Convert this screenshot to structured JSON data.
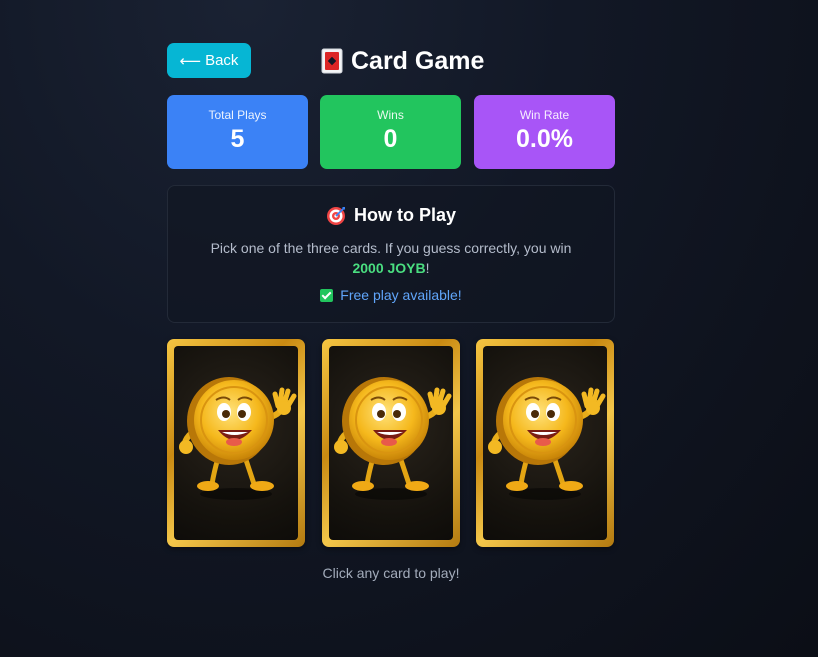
{
  "header": {
    "back_label": "Back",
    "title": "Card Game",
    "title_icon": "playing-card-icon"
  },
  "stats": {
    "total_plays_label": "Total Plays",
    "total_plays_value": "5",
    "wins_label": "Wins",
    "wins_value": "0",
    "win_rate_label": "Win Rate",
    "win_rate_value": "0.0%"
  },
  "howto": {
    "title": "How to Play",
    "icon": "target-icon",
    "text_before": "Pick one of the three cards. If you guess correctly, you win",
    "prize": "2000 JOYB",
    "text_after": "!",
    "free_play": "Free play available!"
  },
  "cards": {
    "count": 3,
    "image": "coin-mascot"
  },
  "hint": "Click any card to play!",
  "colors": {
    "back_button": "#06b6d4",
    "total_plays": "#3b82f6",
    "wins": "#22c55e",
    "win_rate": "#a855f7",
    "prize": "#4ade80",
    "free_play": "#60a5fa"
  }
}
